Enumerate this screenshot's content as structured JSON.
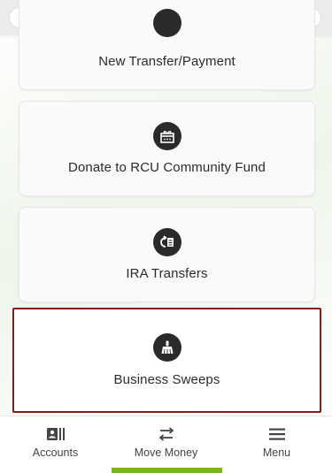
{
  "search": {
    "placeholder": "",
    "icon": "search-icon"
  },
  "cards": [
    {
      "label": "New Transfer/Payment",
      "icon": "transfer-icon"
    },
    {
      "label": "Donate to RCU Community Fund",
      "icon": "gift-icon"
    },
    {
      "label": "IRA Transfers",
      "icon": "ira-icon"
    },
    {
      "label": "Business Sweeps",
      "icon": "broom-icon",
      "highlighted": true
    }
  ],
  "bottom_nav": {
    "items": [
      {
        "label": "Accounts",
        "icon": "accounts-icon"
      },
      {
        "label": "Move Money",
        "icon": "swap-arrows-icon",
        "active": true
      },
      {
        "label": "Menu",
        "icon": "hamburger-icon"
      }
    ]
  },
  "colors": {
    "highlight_border": "#8b1a1a",
    "active_bar": "#7cb518",
    "icon_bg": "#2a2a2a"
  }
}
